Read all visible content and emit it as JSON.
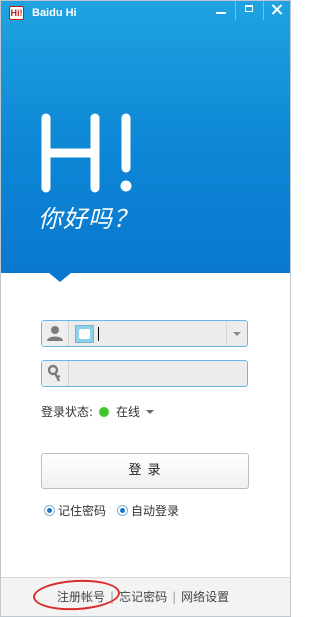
{
  "window": {
    "title": "Baidu Hi",
    "logo_text": "Hi!",
    "icons": [
      "minimize-icon",
      "maximize-icon",
      "close-icon"
    ]
  },
  "brand": {
    "colors": {
      "header_blue": "#0d86d5",
      "field_border": "#65b9e6",
      "status_online": "#44c42f",
      "annotation_red": "#d92b2b"
    }
  },
  "header": {
    "big_text": "H!",
    "greeting": "你好吗？"
  },
  "login": {
    "account_value": "",
    "password_value": "",
    "account_icon": "user-icon",
    "password_icon": "key-icon",
    "status_label": "登录状态:",
    "status_value": "在线",
    "login_button": "登  录",
    "remember_password": "记住密码",
    "auto_login": "自动登录"
  },
  "footer": {
    "register": "注册帐号",
    "sep1": "|",
    "forgot": "忘记密码",
    "sep2": "|",
    "network": "网络设置"
  }
}
